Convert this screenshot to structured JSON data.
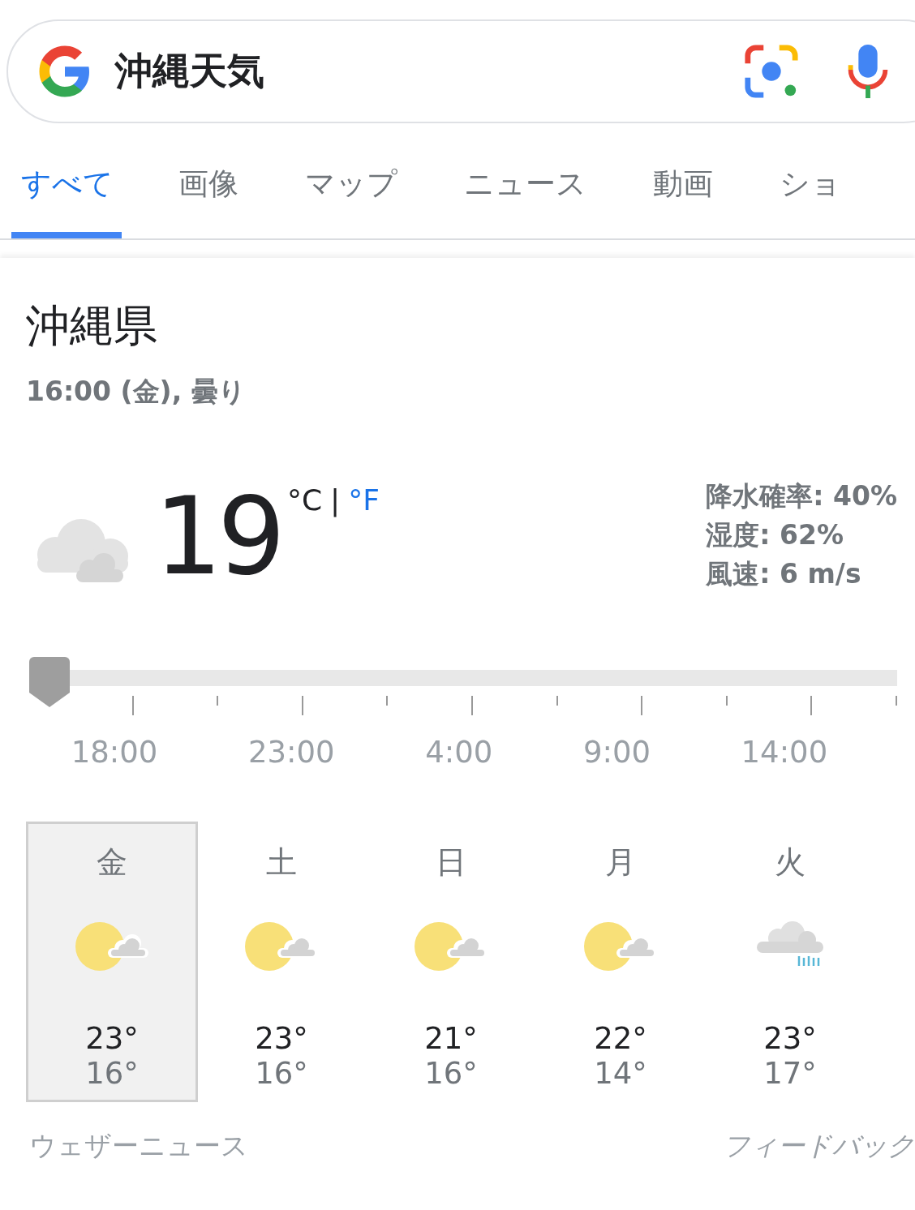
{
  "search": {
    "query": "沖縄天気"
  },
  "tabs": [
    {
      "label": "すべて",
      "selected": true
    },
    {
      "label": "画像",
      "selected": false
    },
    {
      "label": "マップ",
      "selected": false
    },
    {
      "label": "ニュース",
      "selected": false
    },
    {
      "label": "動画",
      "selected": false
    },
    {
      "label": "ショ",
      "selected": false
    }
  ],
  "weather": {
    "location": "沖縄県",
    "subtitle": "16:00 (金), 曇り",
    "temperature": "19",
    "units": [
      {
        "label": "°C",
        "selected": true
      },
      {
        "label": "°F",
        "selected": false
      }
    ],
    "separator": "|",
    "details": [
      "降水確率: 40%",
      "湿度: 62%",
      "風速: 6 m/s"
    ],
    "timeline": {
      "level": 0,
      "times": [
        "18:00",
        "23:00",
        "4:00",
        "9:00",
        "14:00"
      ]
    },
    "days": [
      {
        "day": "金",
        "kind": "sun_cloud",
        "high": "23°",
        "low": "16°",
        "selected": true
      },
      {
        "day": "土",
        "kind": "sun_cloud",
        "high": "23°",
        "low": "16°",
        "selected": false
      },
      {
        "day": "日",
        "kind": "sun_cloud",
        "high": "21°",
        "low": "16°",
        "selected": false
      },
      {
        "day": "月",
        "kind": "sun_cloud",
        "high": "22°",
        "low": "14°",
        "selected": false
      },
      {
        "day": "火",
        "kind": "rain_cloud",
        "high": "23°",
        "low": "17°",
        "selected": false
      }
    ],
    "source": "ウェザーニュース",
    "feedback": "フィードバック"
  }
}
